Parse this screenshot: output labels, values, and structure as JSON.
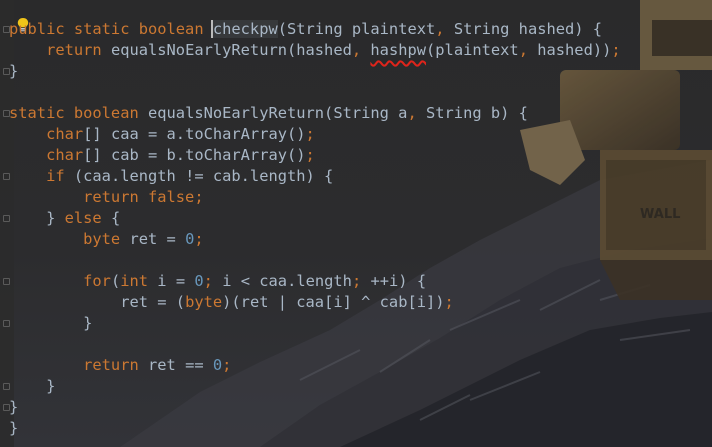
{
  "editor": {
    "lines": [
      [
        [
          "kw",
          "public static boolean "
        ],
        [
          "caret",
          "checkpw"
        ],
        [
          "pl",
          "(String plaintext"
        ],
        [
          "kw",
          ", "
        ],
        [
          "pl",
          "String hashed) {"
        ]
      ],
      [
        [
          "kw",
          "    return "
        ],
        [
          "pl",
          "equalsNoEarlyReturn(hashed"
        ],
        [
          "kw",
          ", "
        ],
        [
          "err",
          "hashpw"
        ],
        [
          "pl",
          "(plaintext"
        ],
        [
          "kw",
          ", "
        ],
        [
          "pl",
          "hashed))"
        ],
        [
          "kw",
          ";"
        ]
      ],
      [
        [
          "pl",
          "}"
        ]
      ],
      [
        [
          "pl",
          ""
        ]
      ],
      [
        [
          "kw",
          "static boolean "
        ],
        [
          "pl",
          "equalsNoEarlyReturn(String a"
        ],
        [
          "kw",
          ", "
        ],
        [
          "pl",
          "String b) {"
        ]
      ],
      [
        [
          "kw",
          "    char"
        ],
        [
          "pl",
          "[] caa = a.toCharArray()"
        ],
        [
          "kw",
          ";"
        ]
      ],
      [
        [
          "kw",
          "    char"
        ],
        [
          "pl",
          "[] cab = b.toCharArray()"
        ],
        [
          "kw",
          ";"
        ]
      ],
      [
        [
          "kw",
          "    if "
        ],
        [
          "pl",
          "(caa.length != cab.length) {"
        ]
      ],
      [
        [
          "kw",
          "        return false;"
        ]
      ],
      [
        [
          "pl",
          "    } "
        ],
        [
          "kw",
          "else "
        ],
        [
          "pl",
          "{"
        ]
      ],
      [
        [
          "kw",
          "        byte "
        ],
        [
          "pl",
          "ret = "
        ],
        [
          "num",
          "0"
        ],
        [
          "kw",
          ";"
        ]
      ],
      [
        [
          "pl",
          ""
        ]
      ],
      [
        [
          "kw",
          "        for"
        ],
        [
          "pl",
          "("
        ],
        [
          "kw",
          "int "
        ],
        [
          "pl",
          "i = "
        ],
        [
          "num",
          "0"
        ],
        [
          "kw",
          "; "
        ],
        [
          "pl",
          "i < caa.length"
        ],
        [
          "kw",
          "; "
        ],
        [
          "pl",
          "++i) {"
        ]
      ],
      [
        [
          "pl",
          "            ret = ("
        ],
        [
          "kw",
          "byte"
        ],
        [
          "pl",
          ")(ret | caa[i] ^ cab[i])"
        ],
        [
          "kw",
          ";"
        ]
      ],
      [
        [
          "pl",
          "        }"
        ]
      ],
      [
        [
          "pl",
          ""
        ]
      ],
      [
        [
          "kw",
          "        return "
        ],
        [
          "pl",
          "ret == "
        ],
        [
          "num",
          "0"
        ],
        [
          "kw",
          ";"
        ]
      ],
      [
        [
          "pl",
          "    }"
        ]
      ],
      [
        [
          "pl",
          "}"
        ]
      ],
      [
        [
          "pl",
          "}"
        ]
      ]
    ],
    "intention_icon": "lightbulb-icon",
    "error_color": "#e0241b"
  }
}
